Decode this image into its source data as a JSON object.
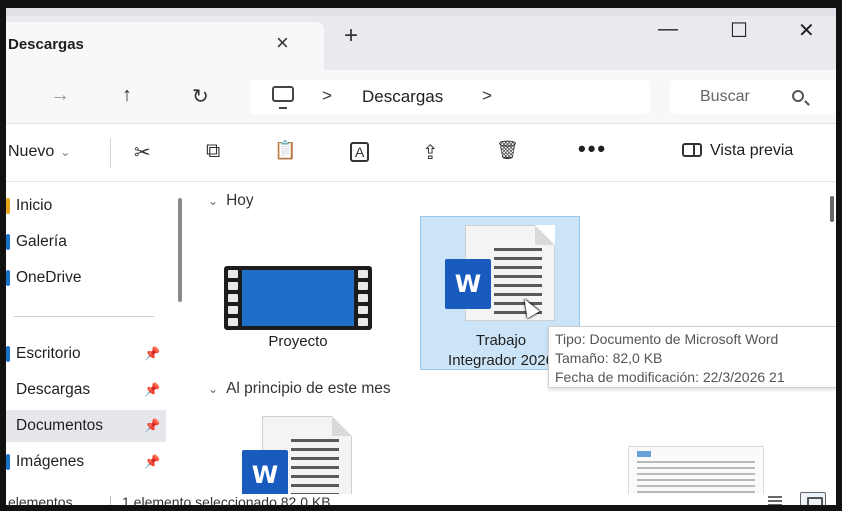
{
  "window": {
    "tab_title": "Descargas",
    "tab_close": "×",
    "new_tab": "+",
    "minimize": "—",
    "maximize": "☐",
    "close": "✕"
  },
  "address": {
    "back": "←",
    "forward": "→",
    "up": "↑",
    "refresh": "↻",
    "separator": ">",
    "path": [
      "Descargas"
    ],
    "search_placeholder": "Buscar"
  },
  "commands": {
    "new_label": "Nuevo",
    "new_chevron": "⌄",
    "cut": "✂",
    "copy": "⧉",
    "paste": "📋",
    "rename": "A",
    "share": "⇪",
    "delete": "🗑",
    "more": "•••",
    "preview_label": "Vista previa"
  },
  "sidebar": {
    "items": [
      {
        "label": "Inicio",
        "color": "#e8a417"
      },
      {
        "label": "Galería",
        "color": "#1a73c9"
      },
      {
        "label": "OneDrive",
        "color": "#1a73c9"
      },
      {
        "label": "Escritorio",
        "color": "#1a73c9",
        "pinned": true
      },
      {
        "label": "Descargas",
        "color": "#1a9c5a",
        "pinned": true
      },
      {
        "label": "Documentos",
        "color": "#8a8a8a",
        "pinned": true,
        "selected": true
      },
      {
        "label": "Imágenes",
        "color": "#1a73c9",
        "pinned": true
      }
    ],
    "pin_icon": "📌"
  },
  "content": {
    "groups": [
      {
        "label": "Hoy",
        "chevron": "⌄"
      },
      {
        "label": "Al principio de este mes",
        "chevron": "⌄"
      }
    ],
    "files_today": [
      {
        "name": "Proyecto",
        "type": "video"
      },
      {
        "name_line1": "Trabajo",
        "name_line2": "Integrador 2026",
        "type": "word",
        "selected": true
      }
    ],
    "word_letter": "W"
  },
  "tooltip": {
    "line1": "Tipo: Documento de Microsoft Word",
    "line2": "Tamaño: 82,0 KB",
    "line3": "Fecha de modificación: 22/3/2026 21"
  },
  "status": {
    "count": "elementos",
    "selection": "1 elemento seleccionado  82,0 KB"
  },
  "colors": {
    "accent": "#185abd",
    "selection": "#cce4f7",
    "video": "#1f6fc8"
  }
}
